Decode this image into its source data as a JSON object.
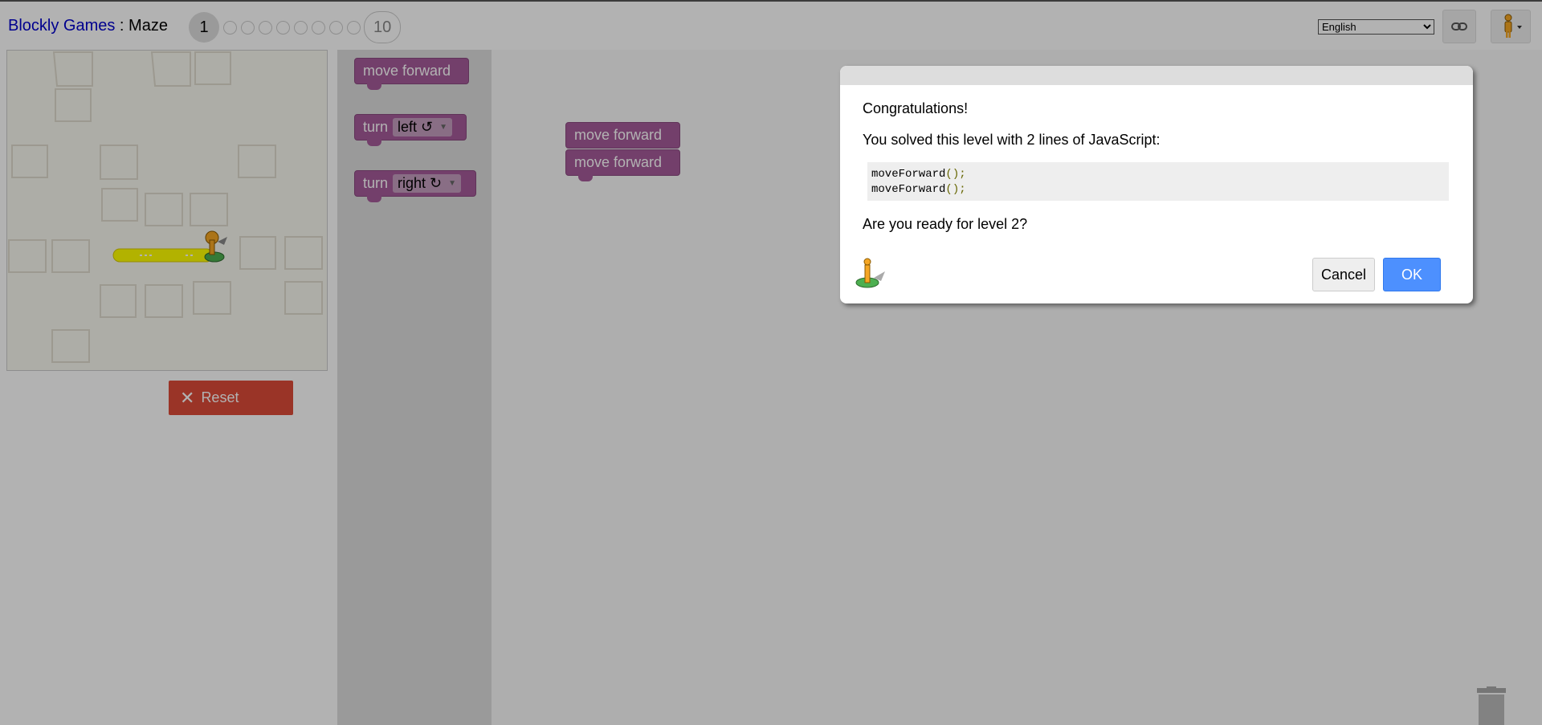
{
  "header": {
    "app_name": "Blockly Games",
    "separator": " : ",
    "game_name": "Maze",
    "current_level": "1",
    "last_level": "10",
    "language": "English"
  },
  "maze": {
    "reset_label": "Reset"
  },
  "toolbox": {
    "move_forward": "move forward",
    "turn_left_word": "turn",
    "turn_left_value": "left ↺",
    "turn_right_word": "turn",
    "turn_right_value": "right ↻"
  },
  "workspace": {
    "block1": "move forward",
    "block2": "move forward"
  },
  "dialog": {
    "congrats": "Congratulations!",
    "solved": "You solved this level with 2 lines of JavaScript:",
    "code_fn": "moveForward",
    "code_args": "();",
    "ready": "Are you ready for level 2?",
    "cancel_label": "Cancel",
    "ok_label": "OK"
  },
  "colors": {
    "block_purple": "#a55b9a",
    "reset_red": "#dd4b39",
    "ok_blue": "#4d90fe",
    "path_yellow": "#ffff00"
  },
  "icons": [
    "link-icon",
    "pegman-icon",
    "close-x-icon",
    "trash-icon",
    "dropdown-arrow-icon"
  ]
}
